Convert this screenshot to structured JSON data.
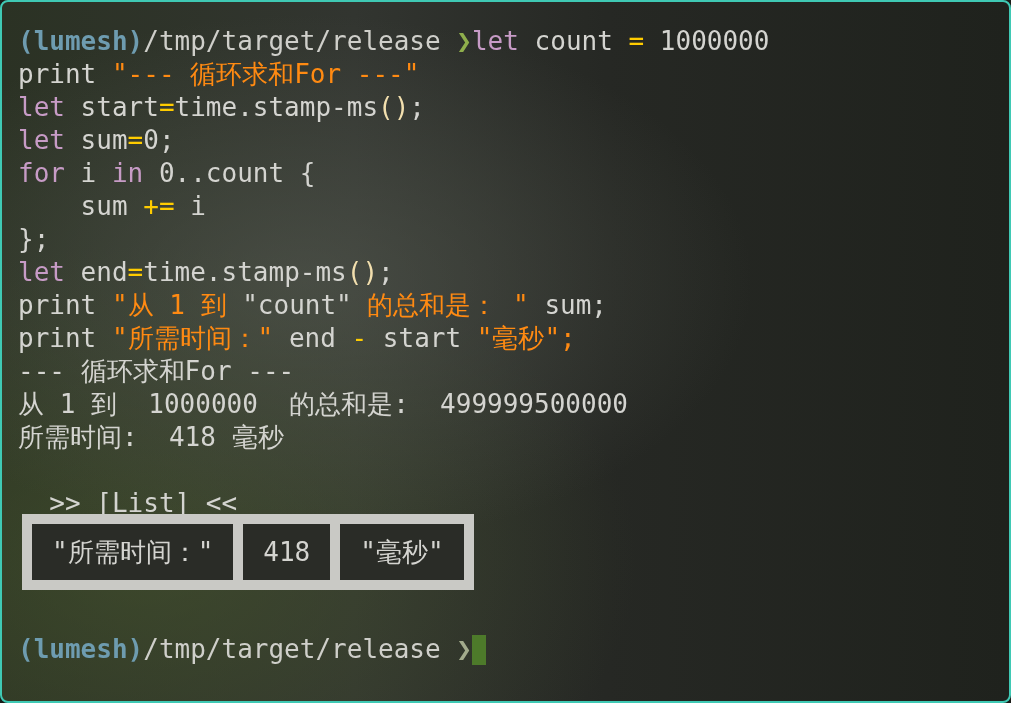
{
  "transcript": [
    {
      "kind": "code",
      "cursor": false,
      "segments": [
        {
          "kind": "env",
          "text": "(lumesh)"
        },
        {
          "kind": "path",
          "text": "/tmp/target/release "
        },
        {
          "kind": "arrow",
          "text": "❯"
        },
        {
          "kind": "keyword",
          "text": "let"
        },
        {
          "kind": "plain",
          "text": " count "
        },
        {
          "kind": "operator",
          "text": "="
        },
        {
          "kind": "plain",
          "text": " 1000000"
        }
      ]
    },
    {
      "kind": "code",
      "cursor": false,
      "segments": [
        {
          "kind": "plain",
          "text": "print "
        },
        {
          "kind": "string",
          "text": "\"--- 循环求和For ---\""
        }
      ]
    },
    {
      "kind": "code",
      "cursor": false,
      "segments": [
        {
          "kind": "keyword",
          "text": "let"
        },
        {
          "kind": "plain",
          "text": " start"
        },
        {
          "kind": "operator",
          "text": "="
        },
        {
          "kind": "plain",
          "text": "time.stamp-ms"
        },
        {
          "kind": "paren",
          "text": "()"
        },
        {
          "kind": "plain",
          "text": ";"
        }
      ]
    },
    {
      "kind": "code",
      "cursor": false,
      "segments": [
        {
          "kind": "keyword",
          "text": "let"
        },
        {
          "kind": "plain",
          "text": " sum"
        },
        {
          "kind": "operator",
          "text": "="
        },
        {
          "kind": "plain",
          "text": "0;"
        }
      ]
    },
    {
      "kind": "code",
      "cursor": false,
      "segments": [
        {
          "kind": "keyword",
          "text": "for"
        },
        {
          "kind": "plain",
          "text": " i "
        },
        {
          "kind": "keyword",
          "text": "in"
        },
        {
          "kind": "plain",
          "text": " 0..count {"
        }
      ]
    },
    {
      "kind": "code",
      "cursor": false,
      "segments": [
        {
          "kind": "plain",
          "text": "    sum "
        },
        {
          "kind": "operator",
          "text": "+="
        },
        {
          "kind": "plain",
          "text": " i"
        }
      ]
    },
    {
      "kind": "code",
      "cursor": false,
      "segments": [
        {
          "kind": "plain",
          "text": "};"
        }
      ]
    },
    {
      "kind": "code",
      "cursor": false,
      "segments": [
        {
          "kind": "keyword",
          "text": "let"
        },
        {
          "kind": "plain",
          "text": " end"
        },
        {
          "kind": "operator",
          "text": "="
        },
        {
          "kind": "plain",
          "text": "time.stamp-ms"
        },
        {
          "kind": "paren",
          "text": "()"
        },
        {
          "kind": "plain",
          "text": ";"
        }
      ]
    },
    {
      "kind": "code",
      "cursor": false,
      "segments": [
        {
          "kind": "plain",
          "text": "print "
        },
        {
          "kind": "string",
          "text": "\"从 1 到 "
        },
        {
          "kind": "plain",
          "text": "\"count\" "
        },
        {
          "kind": "string",
          "text": "的总和是： \""
        },
        {
          "kind": "plain",
          "text": " sum;"
        }
      ]
    },
    {
      "kind": "code",
      "cursor": false,
      "segments": [
        {
          "kind": "plain",
          "text": "print "
        },
        {
          "kind": "string",
          "text": "\"所需时间：\""
        },
        {
          "kind": "plain",
          "text": " end "
        },
        {
          "kind": "operator",
          "text": "-"
        },
        {
          "kind": "plain",
          "text": " start "
        },
        {
          "kind": "string",
          "text": "\"毫秒\";"
        }
      ]
    },
    {
      "kind": "output",
      "text": "--- 循环求和For ---"
    },
    {
      "kind": "output",
      "text": "从 1 到  1000000  的总和是:  499999500000"
    },
    {
      "kind": "output",
      "text": "所需时间:  418 毫秒"
    },
    {
      "kind": "blank"
    },
    {
      "kind": "output",
      "text": "  >> [List] <<"
    },
    {
      "kind": "list",
      "items": [
        "\"所需时间：\"",
        "418",
        "\"毫秒\""
      ]
    },
    {
      "kind": "blank"
    },
    {
      "kind": "code",
      "cursor": true,
      "segments": [
        {
          "kind": "env",
          "text": "(lumesh)"
        },
        {
          "kind": "path",
          "text": "/tmp/target/release "
        },
        {
          "kind": "arrow_dim",
          "text": "❯"
        }
      ]
    }
  ]
}
